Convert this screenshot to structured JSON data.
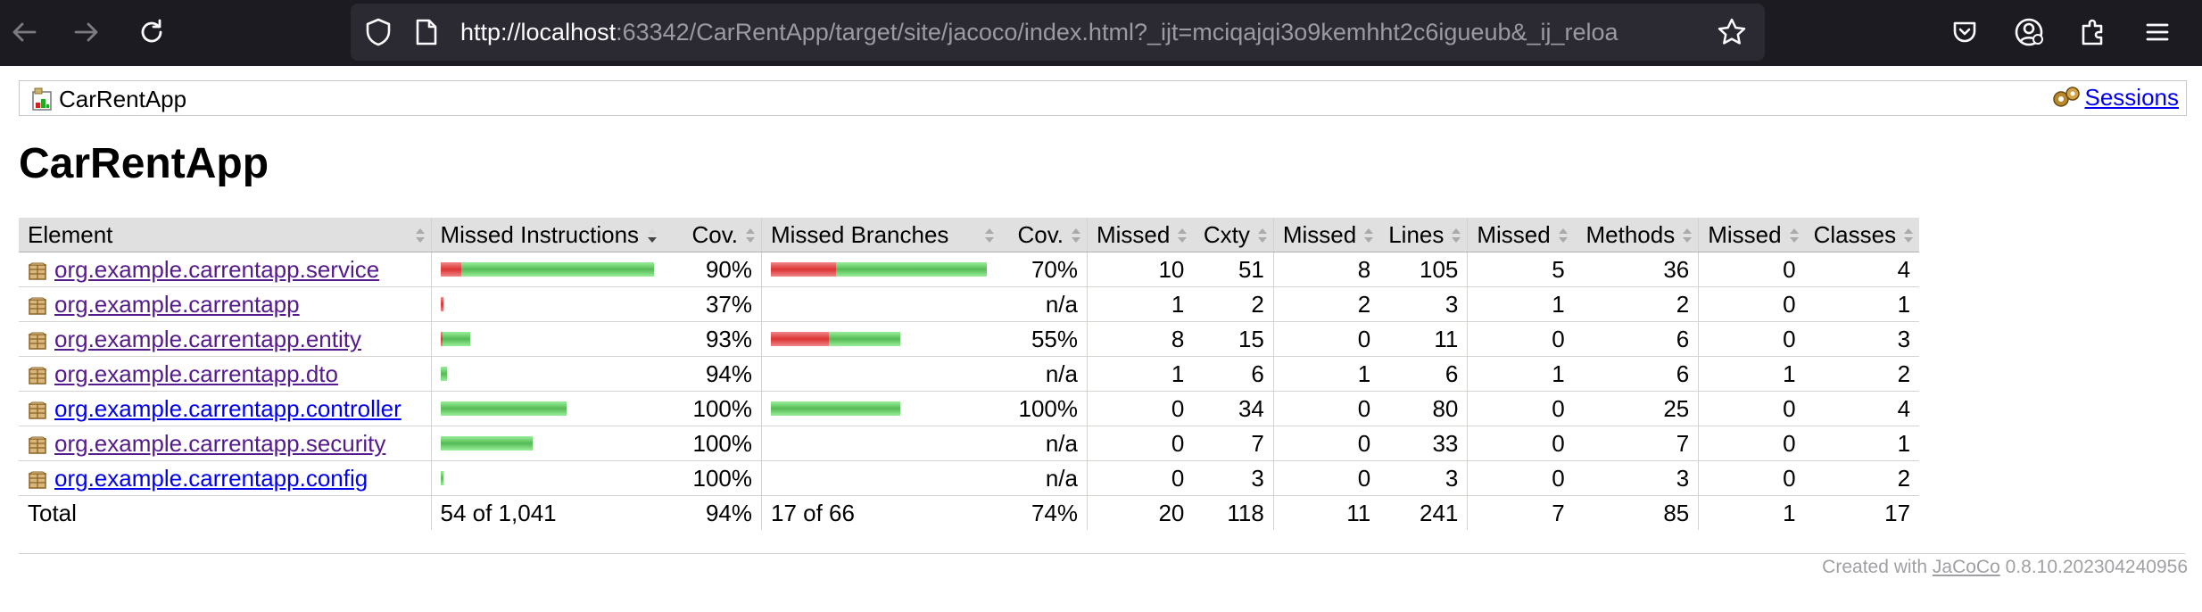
{
  "browser": {
    "url_host": "http://localhost",
    "url_rest": ":63342/CarRentApp/target/site/jacoco/index.html?_ijt=mciqajqi3o9kemhht2c6igueub&_ij_reloa",
    "toolbar_bg": "#1c1b22"
  },
  "breadcrumb": {
    "report_label": "CarRentApp",
    "sessions_label": "Sessions"
  },
  "page": {
    "title": "CarRentApp"
  },
  "table": {
    "headers": [
      "Element",
      "Missed Instructions",
      "Cov.",
      "Missed Branches",
      "Cov.",
      "Missed",
      "Cxty",
      "Missed",
      "Lines",
      "Missed",
      "Methods",
      "Missed",
      "Classes"
    ],
    "rows": [
      {
        "name": "org.example.carrentapp.service",
        "instr_cov": "90%",
        "instr_missed_frac": 0.095,
        "instr_scale": 1.0,
        "branch_cov": "70%",
        "branch_missed_frac": 0.3,
        "branch_scale": 1.0,
        "cxty_missed": "10",
        "cxty": "51",
        "lines_missed": "8",
        "lines": "105",
        "methods_missed": "5",
        "methods": "36",
        "classes_missed": "0",
        "classes": "4",
        "visited": true
      },
      {
        "name": "org.example.carrentapp",
        "instr_cov": "37%",
        "instr_missed_frac": 1.0,
        "instr_scale": 0.01,
        "branch_cov": "n/a",
        "branch_missed_frac": null,
        "branch_scale": 0,
        "cxty_missed": "1",
        "cxty": "2",
        "lines_missed": "2",
        "lines": "3",
        "methods_missed": "1",
        "methods": "2",
        "classes_missed": "0",
        "classes": "1",
        "visited": true
      },
      {
        "name": "org.example.carrentapp.entity",
        "instr_cov": "93%",
        "instr_missed_frac": 0.07,
        "instr_scale": 0.14,
        "branch_cov": "55%",
        "branch_missed_frac": 0.45,
        "branch_scale": 0.6,
        "cxty_missed": "8",
        "cxty": "15",
        "lines_missed": "0",
        "lines": "11",
        "methods_missed": "0",
        "methods": "6",
        "classes_missed": "0",
        "classes": "3",
        "visited": true
      },
      {
        "name": "org.example.carrentapp.dto",
        "instr_cov": "94%",
        "instr_missed_frac": 0.06,
        "instr_scale": 0.03,
        "branch_cov": "n/a",
        "branch_missed_frac": null,
        "branch_scale": 0,
        "cxty_missed": "1",
        "cxty": "6",
        "lines_missed": "1",
        "lines": "6",
        "methods_missed": "1",
        "methods": "6",
        "classes_missed": "1",
        "classes": "2",
        "visited": true
      },
      {
        "name": "org.example.carrentapp.controller",
        "instr_cov": "100%",
        "instr_missed_frac": 0,
        "instr_scale": 0.59,
        "branch_cov": "100%",
        "branch_missed_frac": 0,
        "branch_scale": 0.6,
        "cxty_missed": "0",
        "cxty": "34",
        "lines_missed": "0",
        "lines": "80",
        "methods_missed": "0",
        "methods": "25",
        "classes_missed": "0",
        "classes": "4",
        "visited": false
      },
      {
        "name": "org.example.carrentapp.security",
        "instr_cov": "100%",
        "instr_missed_frac": 0,
        "instr_scale": 0.43,
        "branch_cov": "n/a",
        "branch_missed_frac": null,
        "branch_scale": 0,
        "cxty_missed": "0",
        "cxty": "7",
        "lines_missed": "0",
        "lines": "33",
        "methods_missed": "0",
        "methods": "7",
        "classes_missed": "0",
        "classes": "1",
        "visited": true
      },
      {
        "name": "org.example.carrentapp.config",
        "instr_cov": "100%",
        "instr_missed_frac": 0,
        "instr_scale": 0.01,
        "branch_cov": "n/a",
        "branch_missed_frac": null,
        "branch_scale": 0,
        "cxty_missed": "0",
        "cxty": "3",
        "lines_missed": "0",
        "lines": "3",
        "methods_missed": "0",
        "methods": "3",
        "classes_missed": "0",
        "classes": "2",
        "visited": false
      }
    ],
    "total": {
      "label": "Total",
      "instr": "54 of 1,041",
      "instr_cov": "94%",
      "branch": "17 of 66",
      "branch_cov": "74%",
      "cxty_missed": "20",
      "cxty": "118",
      "lines_missed": "11",
      "lines": "241",
      "methods_missed": "7",
      "methods": "85",
      "classes_missed": "1",
      "classes": "17"
    }
  },
  "footer": {
    "prefix": "Created with",
    "link": "JaCoCo",
    "version": "0.8.10.202304240956"
  }
}
